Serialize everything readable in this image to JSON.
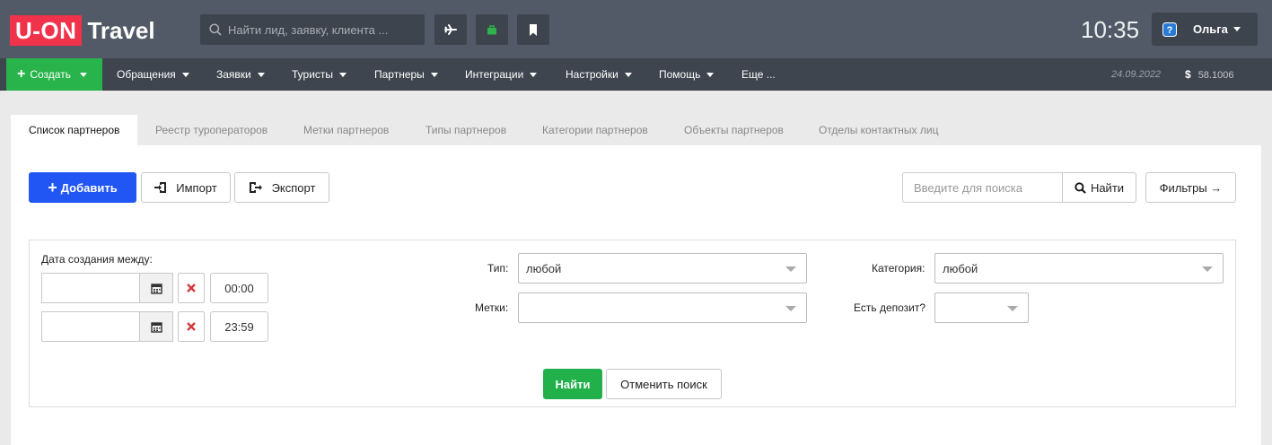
{
  "header": {
    "logo_part1": "U-ON",
    "logo_part2": "Travel",
    "search_placeholder": "Найти лид, заявку, клиента ...",
    "clock": "10:35",
    "user_name": "Ольга",
    "icons": [
      "plane-icon",
      "bag-icon",
      "bookmark-icon",
      "help-icon"
    ],
    "colors": {
      "bg": "#515a66",
      "logo": "#f0324b",
      "bag": "#2eb24b"
    }
  },
  "nav": {
    "create_label": "Создать",
    "items": [
      "Обращения",
      "Заявки",
      "Туристы",
      "Партнеры",
      "Интеграции",
      "Настройки",
      "Помощь",
      "Еще ..."
    ],
    "date": "24.09.2022",
    "currency_symbol": "$",
    "rate": "58.1006"
  },
  "tabs": [
    "Список партнеров",
    "Реестр туроператоров",
    "Метки партнеров",
    "Типы партнеров",
    "Категории партнеров",
    "Объекты партнеров",
    "Отделы контактных лиц"
  ],
  "toolbar": {
    "add_label": "Добавить",
    "import_label": "Импорт",
    "export_label": "Экспорт",
    "search_placeholder": "Введите для поиска",
    "find_label": "Найти",
    "filters_label": "Фильтры →"
  },
  "filters": {
    "date_label": "Дата создания между:",
    "date_from": "",
    "date_to": "",
    "time_from": "00:00",
    "time_to": "23:59",
    "type_label": "Тип:",
    "type_value": "любой",
    "tags_label": "Метки:",
    "tags_value": "",
    "category_label": "Категория:",
    "category_value": "любой",
    "deposit_label": "Есть депозит?",
    "deposit_value": "",
    "search_button": "Найти",
    "cancel_button": "Отменить поиск"
  }
}
